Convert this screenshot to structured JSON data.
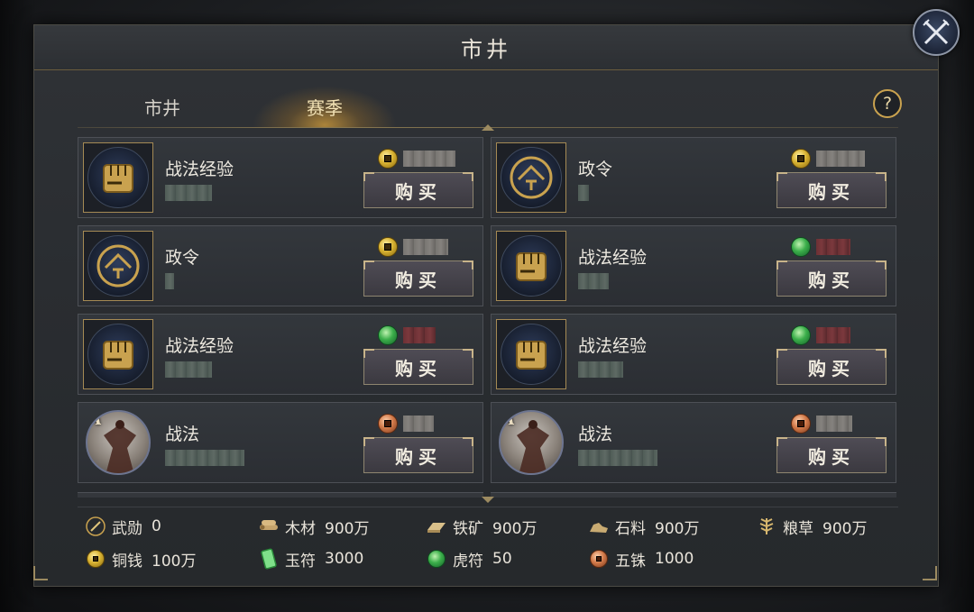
{
  "window": {
    "title": "市井"
  },
  "tabs": [
    {
      "label": "市井",
      "active": false
    },
    {
      "label": "赛季",
      "active": true
    }
  ],
  "help": {
    "label": "?"
  },
  "items": [
    {
      "name": "战法经验",
      "icon": "fist-icon",
      "currency": "copper-money",
      "price_redacted": true,
      "button": "购买"
    },
    {
      "name": "政令",
      "icon": "order-seal-icon",
      "currency": "copper-money",
      "price_redacted": true,
      "button": "购买"
    },
    {
      "name": "政令",
      "icon": "order-seal-icon",
      "currency": "copper-money",
      "price_redacted": true,
      "button": "购买"
    },
    {
      "name": "战法经验",
      "icon": "fist-icon",
      "currency": "tiger-tally",
      "price_redacted": true,
      "button": "购买"
    },
    {
      "name": "战法经验",
      "icon": "fist-icon",
      "currency": "tiger-tally",
      "price_redacted": true,
      "button": "购买"
    },
    {
      "name": "战法经验",
      "icon": "fist-icon",
      "currency": "tiger-tally",
      "price_redacted": true,
      "button": "购买"
    },
    {
      "name": "战法",
      "icon": "warrior-skill-icon",
      "grade": "A",
      "currency": "wuzhu-coin",
      "price_redacted": true,
      "button": "购买"
    },
    {
      "name": "战法",
      "icon": "warrior-skill-icon",
      "grade": "A",
      "currency": "wuzhu-coin",
      "price_redacted": true,
      "button": "购买"
    }
  ],
  "resources": [
    {
      "label": "武勋",
      "value": "0",
      "icon": "sword-icon"
    },
    {
      "label": "木材",
      "value": "900万",
      "icon": "wood-icon"
    },
    {
      "label": "铁矿",
      "value": "900万",
      "icon": "iron-icon"
    },
    {
      "label": "石料",
      "value": "900万",
      "icon": "stone-icon"
    },
    {
      "label": "粮草",
      "value": "900万",
      "icon": "grain-icon"
    },
    {
      "label": "铜钱",
      "value": "100万",
      "icon": "copper-money-icon"
    },
    {
      "label": "玉符",
      "value": "3000",
      "icon": "jade-tally-icon"
    },
    {
      "label": "虎符",
      "value": "50",
      "icon": "tiger-tally-icon"
    },
    {
      "label": "五铢",
      "value": "1000",
      "icon": "wuzhu-coin-icon"
    }
  ],
  "colors": {
    "gold_accent": "#c9a24f",
    "text_primary": "#ece8df",
    "copper_money": "#d8b232",
    "tiger_tally": "#3bae4a",
    "wuzhu_coin": "#d27a4a"
  }
}
